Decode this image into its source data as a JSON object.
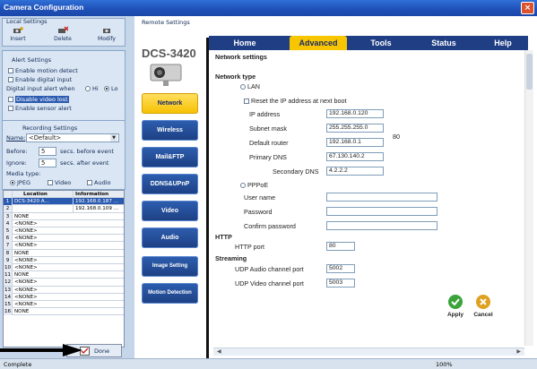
{
  "window": {
    "title": "Camera Configuration",
    "close": "×"
  },
  "left": {
    "local_settings_label": "Local Settings",
    "toolbar": [
      {
        "label": "Insert",
        "icon": "insert-camera-icon"
      },
      {
        "label": "Delete",
        "icon": "delete-camera-icon"
      },
      {
        "label": "Modify",
        "icon": "modify-camera-icon"
      }
    ],
    "alert_settings": {
      "title": "Alert Settings",
      "enable_motion": "Enable motion detect",
      "enable_digital_input": "Enable digital input",
      "digital_input_label": "Digital input alert when",
      "hi": "Hi",
      "lo": "Lo",
      "disable_video_lost": "Disable video lost",
      "enable_sensor_alert": "Enable sensor alert"
    },
    "recording": {
      "title": "Recording Settings",
      "name_label": "Name:",
      "name_value": "<Default>",
      "before_label": "Before:",
      "before_value": "5",
      "before_unit": "secs. before event",
      "after_label": "Ignore:",
      "after_value": "5",
      "after_unit": "secs. after event",
      "media_type_label": "Media type:",
      "media_opts": [
        "JPEG",
        "Video",
        "Audio"
      ]
    },
    "table": {
      "headers": [
        "Location",
        "Information"
      ],
      "rows": [
        {
          "n": "1",
          "loc": "DCS-3420 A...",
          "info": "192.168.0.187 ..."
        },
        {
          "n": "2",
          "loc": "",
          "info": "192.168.0.109 ..."
        },
        {
          "n": "3",
          "loc": "NONE",
          "info": ""
        },
        {
          "n": "4",
          "loc": "<NONE>",
          "info": ""
        },
        {
          "n": "5",
          "loc": "<NONE>",
          "info": ""
        },
        {
          "n": "6",
          "loc": "<NONE>",
          "info": ""
        },
        {
          "n": "7",
          "loc": "<NONE>",
          "info": ""
        },
        {
          "n": "8",
          "loc": "NONE",
          "info": ""
        },
        {
          "n": "9",
          "loc": "<NONE>",
          "info": ""
        },
        {
          "n": "10",
          "loc": "<NONE>",
          "info": ""
        },
        {
          "n": "11",
          "loc": "NONE",
          "info": ""
        },
        {
          "n": "12",
          "loc": "<NONE>",
          "info": ""
        },
        {
          "n": "13",
          "loc": "<NONE>",
          "info": ""
        },
        {
          "n": "14",
          "loc": "<NONE>",
          "info": ""
        },
        {
          "n": "15",
          "loc": "<NONE>",
          "info": ""
        },
        {
          "n": "16",
          "loc": "NONE",
          "info": ""
        }
      ]
    },
    "done_label": "Done"
  },
  "middle": {
    "remote_settings_label": "Remote Settings",
    "model": "DCS-3420",
    "buttons": [
      "Network",
      "Wireless",
      "Mail&FTP",
      "DDNS&UPnP",
      "Video",
      "Audio",
      "Image Setting",
      "Motion Detection"
    ],
    "active": "Network"
  },
  "tabs": [
    "Home",
    "Advanced",
    "Tools",
    "Status",
    "Help"
  ],
  "active_tab": "Advanced",
  "network": {
    "title": "Network settings",
    "network_type": "Network type",
    "lan": "LAN",
    "reset_ip": "Reset the IP address at next boot",
    "ip_label": "IP address",
    "ip": "192.168.0.120",
    "mask_label": "Subnet mask",
    "mask": "255.255.255.0",
    "router_label": "Default router",
    "router": "192.168.0.1",
    "dns1_label": "Primary DNS",
    "dns1": "67.130.140.2",
    "dns2_label": "Secondary DNS",
    "dns2": "4.2.2.2",
    "side_note": "80",
    "pppoe": "PPPoE",
    "user_label": "User name",
    "pass_label": "Password",
    "confirm_label": "Confirm password",
    "http_head": "HTTP",
    "http_port_label": "HTTP port",
    "http_port": "80",
    "streaming_head": "Streaming",
    "udp_audio_label": "UDP Audio channel port",
    "udp_audio": "5002",
    "udp_video_label": "UDP Video channel port",
    "udp_video": "5003",
    "apply": "Apply",
    "cancel": "Cancel"
  },
  "status": {
    "left": "Complete",
    "zoom": "100%"
  },
  "colors": {
    "accent": "#f7c600",
    "navy": "#1f3e84",
    "title": "#1f4fb8"
  }
}
